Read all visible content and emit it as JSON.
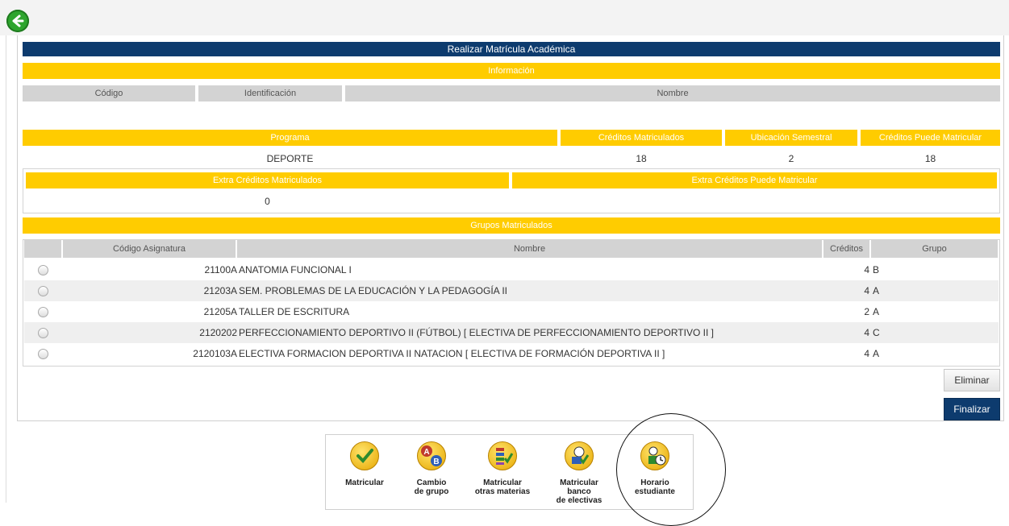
{
  "title": "Realizar Matrícula Académica",
  "informacion": {
    "label": "Información",
    "headers": [
      "Código",
      "Identificación",
      "Nombre"
    ]
  },
  "programa": {
    "headers": [
      "Programa",
      "Créditos Matriculados",
      "Ubicación Semestral",
      "Créditos Puede Matricular"
    ],
    "values": [
      "DEPORTE",
      "18",
      "2",
      "18"
    ]
  },
  "extra": {
    "headers": [
      "Extra Créditos Matriculados",
      "Extra Créditos Puede Matricular"
    ],
    "values": [
      "0",
      ""
    ]
  },
  "grupos": {
    "label": "Grupos Matriculados",
    "headers": [
      "Código Asignatura",
      "Nombre",
      "Créditos",
      "Grupo"
    ],
    "rows": [
      {
        "codigo": "21100A",
        "nombre": "ANATOMIA FUNCIONAL I",
        "creditos": "4",
        "grupo": "B"
      },
      {
        "codigo": "21203A",
        "nombre": "SEM. PROBLEMAS DE LA EDUCACIÓN Y LA PEDAGOGÍA II",
        "creditos": "4",
        "grupo": "A"
      },
      {
        "codigo": "21205A",
        "nombre": "TALLER DE ESCRITURA",
        "creditos": "2",
        "grupo": "A"
      },
      {
        "codigo": "2120202",
        "nombre": "PERFECCIONAMIENTO DEPORTIVO II (FÚTBOL) [ ELECTIVA DE PERFECCIONAMIENTO DEPORTIVO II ]",
        "creditos": "4",
        "grupo": "C"
      },
      {
        "codigo": "2120103A",
        "nombre": "ELECTIVA FORMACION DEPORTIVA II NATACION [ ELECTIVA DE FORMACIÓN DEPORTIVA II ]",
        "creditos": "4",
        "grupo": "A"
      }
    ]
  },
  "buttons": {
    "eliminar": "Eliminar",
    "finalizar": "Finalizar"
  },
  "tools": [
    {
      "label": "Matricular",
      "icon": "check-icon"
    },
    {
      "label": "Cambio\nde grupo",
      "icon": "swap-ab-icon"
    },
    {
      "label": "Matricular\notras materias",
      "icon": "list-icon"
    },
    {
      "label": "Matricular\nbanco\nde electivas",
      "icon": "elective-bank-icon"
    },
    {
      "label": "Horario\nestudiante",
      "icon": "student-schedule-icon"
    }
  ],
  "colors": {
    "navy": "#0d3b6e",
    "yellow": "#ffcc00",
    "gray": "#d3d3d3"
  }
}
